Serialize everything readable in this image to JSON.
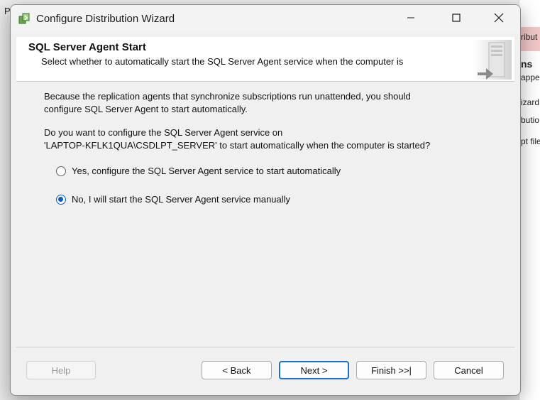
{
  "background": {
    "left_letter": "P",
    "right_panel_lines": [
      "ribut",
      "ns",
      "apper",
      "izard:",
      "butio",
      "pt file"
    ]
  },
  "window": {
    "title": "Configure Distribution Wizard",
    "minimize_glyph": "—",
    "maximize_glyph": "☐",
    "close_glyph": "✕"
  },
  "banner": {
    "title": "SQL Server Agent Start",
    "subtitle": "Select whether to automatically start the SQL Server Agent service when the computer is"
  },
  "body": {
    "paragraph1": [
      "Because the replication agents that synchronize subscriptions run unattended, you should",
      "configure SQL Server Agent to start automatically."
    ],
    "paragraph2": [
      "Do you want to configure the SQL Server Agent service on",
      "'LAPTOP-KFLK1QUA\\CSDLPT_SERVER' to start automatically when the computer is started?"
    ]
  },
  "options": [
    {
      "label": "Yes, configure the SQL Server Agent service to start automatically",
      "selected": false
    },
    {
      "label": "No, I will start the SQL Server Agent service manually",
      "selected": true
    }
  ],
  "buttons": {
    "help": "Help",
    "back": "< Back",
    "next": "Next >",
    "finish": "Finish >>|",
    "cancel": "Cancel"
  },
  "colors": {
    "accent": "#0b5cbf",
    "default_button_border": "#1a6fd1"
  }
}
